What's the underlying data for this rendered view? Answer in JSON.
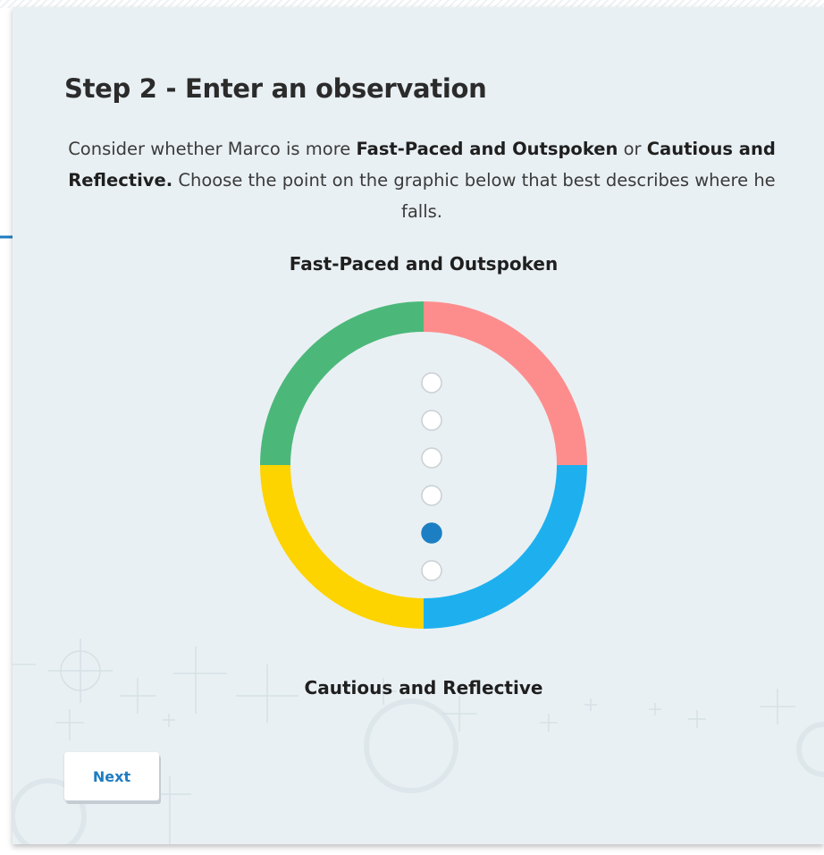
{
  "step": {
    "title": "Step 2 - Enter an observation"
  },
  "instructions": {
    "part1": "Consider whether Marco is more ",
    "bold1": "Fast-Paced and Outspoken",
    "part2": " or ",
    "bold2": "Cautious and Reflective.",
    "part3": " Choose the point on the graphic below that best describes where he falls."
  },
  "scale": {
    "top_label": "Fast-Paced and Outspoken",
    "bottom_label": "Cautious and Reflective",
    "point_count": 6,
    "selected_index": 4,
    "quadrant_colors": {
      "top_left": "#4bb87a",
      "top_right": "#fd8d8d",
      "bottom_right": "#1eb0ee",
      "bottom_left": "#fdd300"
    },
    "selected_color": "#1c7fc3"
  },
  "actions": {
    "next_label": "Next"
  },
  "colors": {
    "arrow": "#1e7cc0",
    "background": "#e9f0f3"
  }
}
